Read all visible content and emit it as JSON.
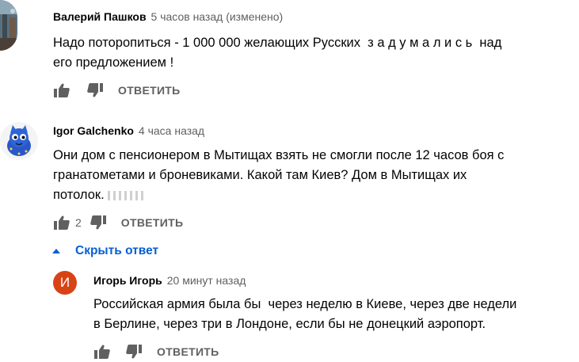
{
  "comments": [
    {
      "author": "Валерий Пашков",
      "time": "5 часов назад (изменено)",
      "text_line1": "Надо поторопиться - 1 000 000 желающих Русских  з а д у м а л и с ь  над",
      "text_line2": "его предложением !",
      "reply_label": "ОТВЕТИТЬ"
    },
    {
      "author": "Igor Galchenko",
      "time": "4 часа назад",
      "text_line1": "Они дом с пенсионером в Мытищах взять не смогли после 12 часов боя с",
      "text_line2": "гранатометами и броневиками. Какой там Киев? Дом в Мытищах их",
      "text_line3": "потолок.",
      "likes": "2",
      "reply_label": "ОТВЕТИТЬ"
    }
  ],
  "toggle": {
    "label": "Скрыть ответ",
    "icon": "chevron-up-icon"
  },
  "reply": {
    "avatar_letter": "И",
    "avatar_color": "#d84315",
    "author": "Игорь Игорь",
    "time": "20 минут назад",
    "text_line1": "Российская армия была бы  через неделю в Киеве, через две недели",
    "text_line2": "в Берлине, через три в Лондоне, если бы не донецкий аэропорт.",
    "reply_label": "ОТВЕТИТЬ"
  },
  "colors": {
    "link": "#065fd4",
    "secondary": "#606060"
  }
}
